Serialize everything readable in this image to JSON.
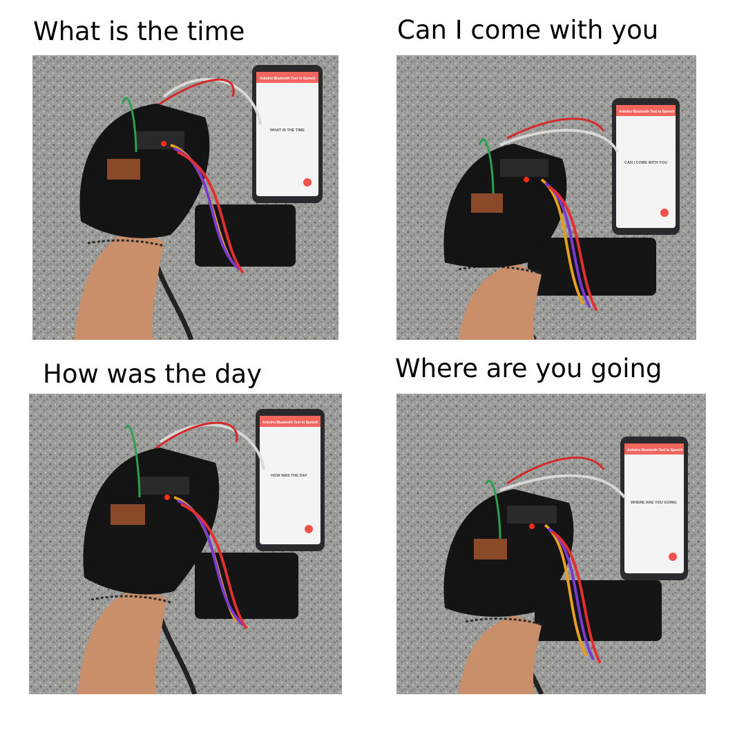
{
  "panels": [
    {
      "caption": "What is the time",
      "phone": {
        "app_title": "Arduino Bluetooth Text to Speech",
        "message": "WHAT IS THE TIME"
      }
    },
    {
      "caption": "Can I come with you",
      "phone": {
        "app_title": "Arduino Bluetooth Text to Speech",
        "message": "CAN I COME WITH YOU"
      }
    },
    {
      "caption": "How was the day",
      "phone": {
        "app_title": "Arduino Bluetooth Text to Speech",
        "message": "HOW WAS THE DAY"
      }
    },
    {
      "caption": "Where are you going",
      "phone": {
        "app_title": "Arduino Bluetooth Text to Speech",
        "message": "WHERE ARE YOU GOING"
      }
    }
  ],
  "colors": {
    "granite": "#9a9a98",
    "glove": "#141414",
    "skin": "#c98f6a",
    "phone_body": "#2a2a2c",
    "phone_screen": "#f4f4f4",
    "app_bar": "#f2665e",
    "fab": "#f0524a",
    "power_bank": "#151515",
    "led": "#ff2a1a"
  },
  "icons": [
    "phone-image",
    "glove-image",
    "power-bank-image"
  ]
}
